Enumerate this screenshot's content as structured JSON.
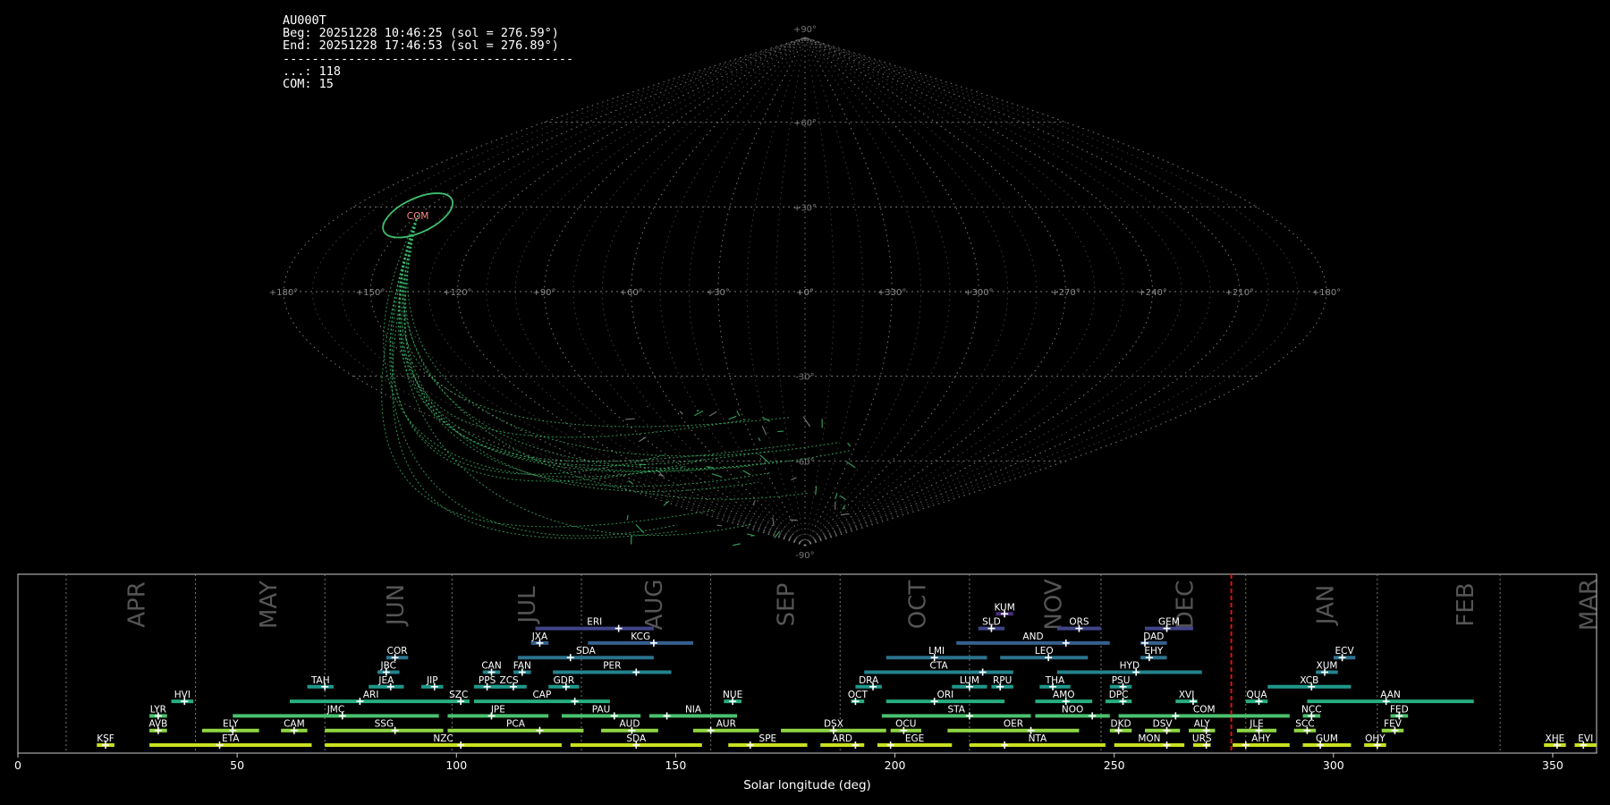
{
  "info": {
    "station": "AU000T",
    "beg": "Beg: 20251228 10:46:25 (sol = 276.59°)",
    "end": "End: 20251228 17:46:53 (sol = 276.89°)",
    "separator": "----------------------------------------",
    "count_sporadic": "...: 118",
    "count_com": "COM: 15"
  },
  "sky": {
    "lat_labels": [
      "+90°",
      "+60°",
      "+30°",
      "+0°",
      "-30°",
      "-60°",
      "-90°"
    ],
    "lat_values": [
      90,
      60,
      30,
      0,
      -30,
      -60,
      -90
    ],
    "lon_labels": [
      "+180°",
      "+150°",
      "+120°",
      "+90°",
      "+60°",
      "+30°",
      "+0°",
      "+330°",
      "+300°",
      "+270°",
      "+240°",
      "+210°",
      "+180°"
    ],
    "radiant_label": "COM",
    "radiant_lon": 150,
    "radiant_lat": 27,
    "grid_color": "#888888",
    "trail_color": "#3fbf6f",
    "radiant_color": "#ff8888"
  },
  "chart_data": {
    "type": "bar",
    "xlabel": "Solar longitude (deg)",
    "xlim": [
      0,
      360
    ],
    "xticks": [
      0,
      50,
      100,
      150,
      200,
      250,
      300,
      350
    ],
    "current_sol": 276.7,
    "month_boundaries": [
      11,
      40.5,
      70,
      99,
      128.5,
      158,
      187.5,
      217,
      247,
      280,
      310,
      338
    ],
    "months": [
      {
        "label": "APR",
        "x": 24
      },
      {
        "label": "MAY",
        "x": 54
      },
      {
        "label": "JUN",
        "x": 83
      },
      {
        "label": "JUL",
        "x": 113
      },
      {
        "label": "AUG",
        "x": 142
      },
      {
        "label": "SEP",
        "x": 172
      },
      {
        "label": "OCT",
        "x": 202
      },
      {
        "label": "NOV",
        "x": 233
      },
      {
        "label": "DEC",
        "x": 263
      },
      {
        "label": "JAN",
        "x": 295
      },
      {
        "label": "FEB",
        "x": 327
      },
      {
        "label": "MAR",
        "x": 355
      }
    ],
    "showers": [
      {
        "name": "KSF",
        "start": 18,
        "end": 22,
        "peak": 20,
        "row": 0
      },
      {
        "name": "ETA",
        "start": 30,
        "end": 67,
        "peak": 46,
        "row": 0
      },
      {
        "name": "NZC",
        "start": 70,
        "end": 124,
        "peak": 101,
        "row": 0
      },
      {
        "name": "SDA",
        "start": 126,
        "end": 156,
        "peak": 141,
        "row": 0
      },
      {
        "name": "SPE",
        "start": 162,
        "end": 180,
        "peak": 167,
        "row": 0
      },
      {
        "name": "ARD",
        "start": 183,
        "end": 193,
        "peak": 191,
        "row": 0
      },
      {
        "name": "EGE",
        "start": 196,
        "end": 213,
        "peak": 199,
        "row": 0
      },
      {
        "name": "NTA",
        "start": 217,
        "end": 248,
        "peak": 225,
        "row": 0
      },
      {
        "name": "MON",
        "start": 250,
        "end": 266,
        "peak": 262,
        "row": 0
      },
      {
        "name": "URS",
        "start": 268,
        "end": 272,
        "peak": 271,
        "row": 0
      },
      {
        "name": "AHY",
        "start": 277,
        "end": 290,
        "peak": 280,
        "row": 0
      },
      {
        "name": "GUM",
        "start": 293,
        "end": 304,
        "peak": 297,
        "row": 0
      },
      {
        "name": "OHY",
        "start": 307,
        "end": 312,
        "peak": 310,
        "row": 0
      },
      {
        "name": "XHE",
        "start": 348,
        "end": 353,
        "peak": 351,
        "row": 0
      },
      {
        "name": "EVI",
        "start": 355,
        "end": 360,
        "peak": 357,
        "row": 0
      },
      {
        "name": "AVB",
        "start": 30,
        "end": 34,
        "peak": 32,
        "row": 1
      },
      {
        "name": "ELY",
        "start": 42,
        "end": 55,
        "peak": 49,
        "row": 1
      },
      {
        "name": "CAM",
        "start": 60,
        "end": 66,
        "peak": 63,
        "row": 1
      },
      {
        "name": "SSG",
        "start": 70,
        "end": 97,
        "peak": 86,
        "row": 1
      },
      {
        "name": "PCA",
        "start": 98,
        "end": 129,
        "peak": 119,
        "row": 1
      },
      {
        "name": "AUD",
        "start": 133,
        "end": 146,
        "peak": 140,
        "row": 1
      },
      {
        "name": "AUR",
        "start": 154,
        "end": 169,
        "peak": 158,
        "row": 1
      },
      {
        "name": "DSX",
        "start": 174,
        "end": 198,
        "peak": 186,
        "row": 1
      },
      {
        "name": "OCU",
        "start": 199,
        "end": 206,
        "peak": 202,
        "row": 1
      },
      {
        "name": "OER",
        "start": 212,
        "end": 242,
        "peak": 231,
        "row": 1
      },
      {
        "name": "DKD",
        "start": 249,
        "end": 254,
        "peak": 251,
        "row": 1
      },
      {
        "name": "DSV",
        "start": 257,
        "end": 265,
        "peak": 262,
        "row": 1
      },
      {
        "name": "ALY",
        "start": 267,
        "end": 273,
        "peak": 271,
        "row": 1
      },
      {
        "name": "JLE",
        "start": 278,
        "end": 287,
        "peak": 283,
        "row": 1
      },
      {
        "name": "SCC",
        "start": 291,
        "end": 296,
        "peak": 294,
        "row": 1
      },
      {
        "name": "FEV",
        "start": 311,
        "end": 316,
        "peak": 314,
        "row": 1
      },
      {
        "name": "LYR",
        "start": 30,
        "end": 34,
        "peak": 32,
        "row": 2
      },
      {
        "name": "JMC",
        "start": 49,
        "end": 96,
        "peak": 74,
        "row": 2
      },
      {
        "name": "JPE",
        "start": 98,
        "end": 121,
        "peak": 108,
        "row": 2
      },
      {
        "name": "PAU",
        "start": 124,
        "end": 142,
        "peak": 136,
        "row": 2
      },
      {
        "name": "NIA",
        "start": 144,
        "end": 164,
        "peak": 148,
        "row": 2
      },
      {
        "name": "STA",
        "start": 197,
        "end": 231,
        "peak": 217,
        "row": 2
      },
      {
        "name": "NOO",
        "start": 232,
        "end": 249,
        "peak": 245,
        "row": 2
      },
      {
        "name": "COM",
        "start": 251,
        "end": 290,
        "peak": 264,
        "row": 2
      },
      {
        "name": "NCC",
        "start": 293,
        "end": 297,
        "peak": 295,
        "row": 2
      },
      {
        "name": "FED",
        "start": 313,
        "end": 317,
        "peak": 315,
        "row": 2
      },
      {
        "name": "HVI",
        "start": 35,
        "end": 40,
        "peak": 38,
        "row": 3
      },
      {
        "name": "ARI",
        "start": 62,
        "end": 99,
        "peak": 78,
        "row": 3
      },
      {
        "name": "SZC",
        "start": 98,
        "end": 103,
        "peak": 101,
        "row": 3
      },
      {
        "name": "CAP",
        "start": 104,
        "end": 135,
        "peak": 127,
        "row": 3
      },
      {
        "name": "NUE",
        "start": 161,
        "end": 165,
        "peak": 163,
        "row": 3
      },
      {
        "name": "OCT",
        "start": 190,
        "end": 193,
        "peak": 191,
        "row": 3
      },
      {
        "name": "ORI",
        "start": 198,
        "end": 225,
        "peak": 209,
        "row": 3
      },
      {
        "name": "AMO",
        "start": 232,
        "end": 245,
        "peak": 239,
        "row": 3
      },
      {
        "name": "DPC",
        "start": 248,
        "end": 254,
        "peak": 252,
        "row": 3
      },
      {
        "name": "XVI",
        "start": 264,
        "end": 269,
        "peak": 268,
        "row": 3
      },
      {
        "name": "QUA",
        "start": 280,
        "end": 285,
        "peak": 283,
        "row": 3
      },
      {
        "name": "AAN",
        "start": 294,
        "end": 332,
        "peak": 312,
        "row": 3
      },
      {
        "name": "TAH",
        "start": 66,
        "end": 72,
        "peak": 70,
        "row": 4
      },
      {
        "name": "JEA",
        "start": 80,
        "end": 88,
        "peak": 85,
        "row": 4
      },
      {
        "name": "JIP",
        "start": 92,
        "end": 97,
        "peak": 95,
        "row": 4
      },
      {
        "name": "PPS",
        "start": 104,
        "end": 110,
        "peak": 107,
        "row": 4
      },
      {
        "name": "ZCS",
        "start": 108,
        "end": 116,
        "peak": 113,
        "row": 4
      },
      {
        "name": "GDR",
        "start": 121,
        "end": 128,
        "peak": 125,
        "row": 4
      },
      {
        "name": "DRA",
        "start": 191,
        "end": 197,
        "peak": 195,
        "row": 4
      },
      {
        "name": "LUM",
        "start": 213,
        "end": 221,
        "peak": 217,
        "row": 4
      },
      {
        "name": "RPU",
        "start": 222,
        "end": 227,
        "peak": 224,
        "row": 4
      },
      {
        "name": "THA",
        "start": 233,
        "end": 240,
        "peak": 236,
        "row": 4
      },
      {
        "name": "PSU",
        "start": 249,
        "end": 254,
        "peak": 252,
        "row": 4
      },
      {
        "name": "XCB",
        "start": 285,
        "end": 304,
        "peak": 295,
        "row": 4
      },
      {
        "name": "JBC",
        "start": 82,
        "end": 87,
        "peak": 84,
        "row": 5
      },
      {
        "name": "CAN",
        "start": 106,
        "end": 110,
        "peak": 108,
        "row": 5
      },
      {
        "name": "FAN",
        "start": 113,
        "end": 117,
        "peak": 115,
        "row": 5
      },
      {
        "name": "PER",
        "start": 122,
        "end": 149,
        "peak": 141,
        "row": 5
      },
      {
        "name": "CTA",
        "start": 193,
        "end": 227,
        "peak": 220,
        "row": 5
      },
      {
        "name": "HYD",
        "start": 237,
        "end": 270,
        "peak": 255,
        "row": 5
      },
      {
        "name": "XUM",
        "start": 296,
        "end": 301,
        "peak": 298,
        "row": 5
      },
      {
        "name": "COR",
        "start": 84,
        "end": 89,
        "peak": 86,
        "row": 6
      },
      {
        "name": "SDA",
        "start": 114,
        "end": 145,
        "peak": 126,
        "row": 6
      },
      {
        "name": "LMI",
        "start": 198,
        "end": 221,
        "peak": 209,
        "row": 6
      },
      {
        "name": "LEO",
        "start": 224,
        "end": 244,
        "peak": 235,
        "row": 6
      },
      {
        "name": "EHY",
        "start": 256,
        "end": 262,
        "peak": 258,
        "row": 6
      },
      {
        "name": "ECV",
        "start": 300,
        "end": 305,
        "peak": 302,
        "row": 6
      },
      {
        "name": "JXA",
        "start": 117,
        "end": 121,
        "peak": 119,
        "row": 7
      },
      {
        "name": "KCG",
        "start": 130,
        "end": 154,
        "peak": 145,
        "row": 7
      },
      {
        "name": "AND",
        "start": 214,
        "end": 249,
        "peak": 239,
        "row": 7
      },
      {
        "name": "DAD",
        "start": 256,
        "end": 262,
        "peak": 257,
        "row": 7
      },
      {
        "name": "ERI",
        "start": 118,
        "end": 145,
        "peak": 137,
        "row": 8
      },
      {
        "name": "SLD",
        "start": 219,
        "end": 225,
        "peak": 222,
        "row": 8
      },
      {
        "name": "ORS",
        "start": 237,
        "end": 247,
        "peak": 242,
        "row": 8
      },
      {
        "name": "GEM",
        "start": 257,
        "end": 268,
        "peak": 262,
        "row": 8
      },
      {
        "name": "KUM",
        "start": 223,
        "end": 227,
        "peak": 225,
        "row": 9
      }
    ]
  }
}
